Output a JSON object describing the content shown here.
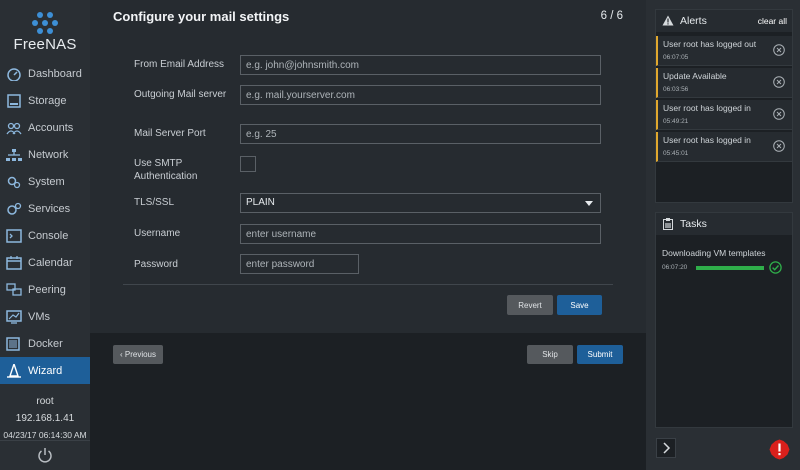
{
  "app": {
    "logo_text": "FreeNAS"
  },
  "sidebar": {
    "items": [
      {
        "label": "Dashboard",
        "icon": "dashboard-icon"
      },
      {
        "label": "Storage",
        "icon": "storage-icon"
      },
      {
        "label": "Accounts",
        "icon": "accounts-icon"
      },
      {
        "label": "Network",
        "icon": "network-icon"
      },
      {
        "label": "System",
        "icon": "system-icon"
      },
      {
        "label": "Services",
        "icon": "services-icon"
      },
      {
        "label": "Console",
        "icon": "console-icon"
      },
      {
        "label": "Calendar",
        "icon": "calendar-icon"
      },
      {
        "label": "Peering",
        "icon": "peering-icon"
      },
      {
        "label": "VMs",
        "icon": "vms-icon"
      },
      {
        "label": "Docker",
        "icon": "docker-icon"
      },
      {
        "label": "Wizard",
        "icon": "wizard-icon",
        "active": true
      }
    ],
    "user": "root",
    "ip": "192.168.1.41",
    "timestamp": "04/23/17  06:14:30 AM"
  },
  "wizard": {
    "title": "Configure your mail settings",
    "step": "6 / 6",
    "fields": {
      "from_label": "From Email Address",
      "from_placeholder": "e.g. john@johnsmith.com",
      "server_label": "Outgoing Mail server",
      "server_placeholder": "e.g. mail.yourserver.com",
      "port_label": "Mail Server Port",
      "port_placeholder": "e.g. 25",
      "smtp_label": "Use SMTP Authentication",
      "smtp_checked": false,
      "tls_label": "TLS/SSL",
      "tls_value": "PLAIN",
      "username_label": "Username",
      "username_placeholder": "enter username",
      "password_label": "Password",
      "password_placeholder": "enter password"
    },
    "buttons": {
      "revert": "Revert",
      "save": "Save",
      "previous": "Previous",
      "skip": "Skip",
      "submit": "Submit"
    }
  },
  "alerts": {
    "title": "Alerts",
    "clear_all": "clear all",
    "accent_color": "#e0a82e",
    "items": [
      {
        "message": "User root has logged out",
        "time": "06:07:05"
      },
      {
        "message": "Update Available",
        "time": "06:03:56"
      },
      {
        "message": "User root has logged in",
        "time": "05:49:21"
      },
      {
        "message": "User root has logged in",
        "time": "05:45:01"
      }
    ]
  },
  "tasks": {
    "title": "Tasks",
    "items": [
      {
        "name": "Downloading VM templates",
        "time": "06:07:20",
        "progress": 1.0,
        "status": "done",
        "bar_color": "#2fae4a"
      }
    ]
  },
  "colors": {
    "accent": "#1e5f99",
    "error": "#d9201c",
    "success": "#2fae4a"
  }
}
